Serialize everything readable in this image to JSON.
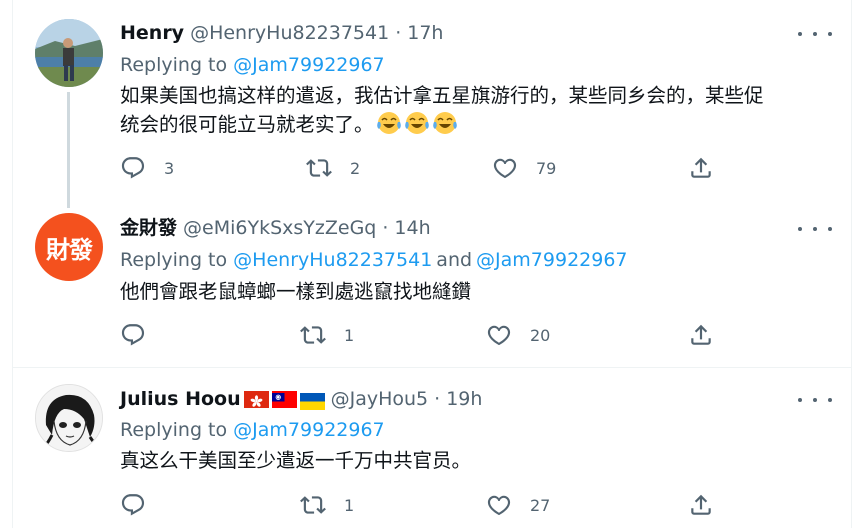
{
  "tweets": [
    {
      "name": "Henry",
      "handle": "@HenryHu82237541",
      "time": "17h",
      "replying_label": "Replying to",
      "mention1": "@Jam79922967",
      "text_line1": "如果美国也搞这样的遣返，我估计拿五星旗游行的，某些同乡会的，某些促",
      "text_line2": "统会的很可能立马就老实了。",
      "reply_count": "3",
      "retweet_count": "2",
      "like_count": "79"
    },
    {
      "name": "金財發",
      "handle": "@eMi6YkSxsYzZeGq",
      "time": "14h",
      "avatar_text": "財發",
      "replying_label": "Replying to",
      "mention1": "@HenryHu82237541",
      "and_text": "and",
      "mention2": "@Jam79922967",
      "text_line1": "他們會跟老鼠蟑螂一樣到處逃竄找地縫鑽",
      "reply_count": "",
      "retweet_count": "1",
      "like_count": "20"
    },
    {
      "name": "Julius Hoou",
      "handle": "@JayHou5",
      "time": "19h",
      "replying_label": "Replying to",
      "mention1": "@Jam79922967",
      "text_line1": "真这么干美国至少遣返一千万中共官员。",
      "reply_count": "",
      "retweet_count": "1",
      "like_count": "27"
    }
  ],
  "colors": {
    "accent": "#1d9bf0",
    "secondary": "#536471",
    "avatar_orange": "#f4511e"
  },
  "icons": [
    "reply-icon",
    "retweet-icon",
    "like-icon",
    "share-icon",
    "more-icon"
  ]
}
